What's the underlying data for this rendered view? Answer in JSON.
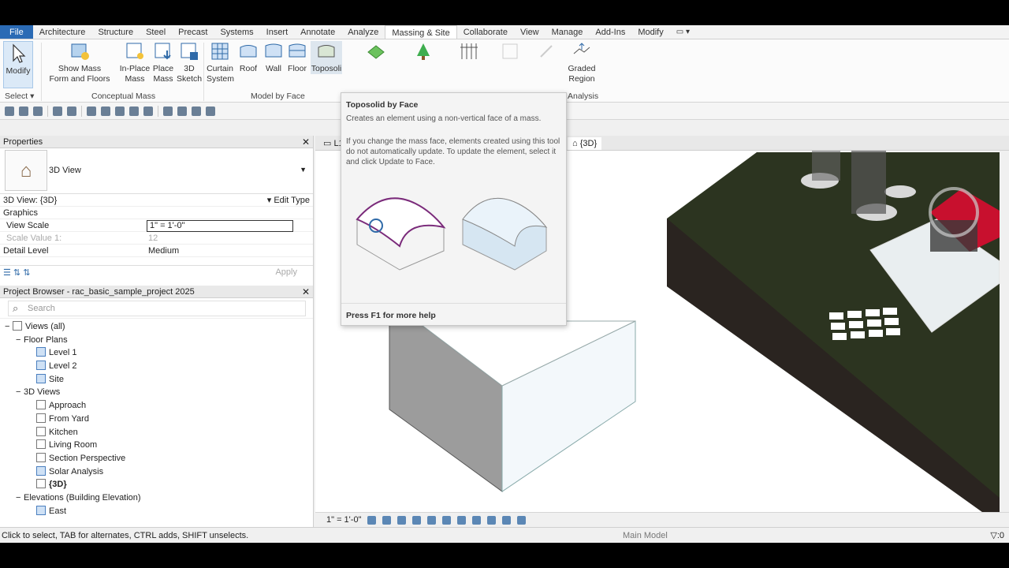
{
  "tabs": [
    "File",
    "Architecture",
    "Structure",
    "Steel",
    "Precast",
    "Systems",
    "Insert",
    "Annotate",
    "Analyze",
    "Massing & Site",
    "Collaborate",
    "View",
    "Manage",
    "Add-Ins",
    "Modify"
  ],
  "active_tab": "Massing & Site",
  "ribbon": {
    "modify": "Modify",
    "select": "Select",
    "show_mass_1": "Show Mass",
    "show_mass_2": "Form and Floors",
    "inplace_1": "In-Place",
    "inplace_2": "Mass",
    "place_1": "Place",
    "place_2": "Mass",
    "sketch_1": "3D",
    "sketch_2": "Sketch",
    "curtain_1": "Curtain",
    "curtain_2": "System",
    "roof": "Roof",
    "wall": "Wall",
    "floor": "Floor",
    "toposolid": "Toposoli",
    "graded_1": "Graded",
    "graded_2": "Region",
    "conceptual_mass": "Conceptual Mass",
    "model_by_face": "Model by Face",
    "analysis": "Analysis"
  },
  "properties": {
    "title": "Properties",
    "type": "3D View",
    "view_label": "3D View: {3D}",
    "edit_type": "Edit Type",
    "graphics": "Graphics",
    "rows": [
      {
        "label": "View Scale",
        "value": "1\" = 1'-0\""
      },
      {
        "label": "Scale Value    1:",
        "value": "12"
      },
      {
        "label": "Detail Level",
        "value": "Medium"
      }
    ],
    "apply": "Apply"
  },
  "browser": {
    "title": "Project Browser - rac_basic_sample_project 2025",
    "search_placeholder": "Search",
    "views_all": "Views (all)",
    "floor_plans": "Floor Plans",
    "floor_items": [
      "Level 1",
      "Level 2",
      "Site"
    ],
    "views_3d": "3D Views",
    "items_3d": [
      "Approach",
      "From Yard",
      "Kitchen",
      "Living Room",
      "Section Perspective",
      "Solar Analysis",
      "{3D}"
    ],
    "elevations": "Elevations (Building Elevation)",
    "elevation_items": [
      "East"
    ]
  },
  "view_tabs": [
    "L1",
    "{3D}"
  ],
  "view_scale": "1\" = 1'-0\"",
  "status": {
    "text": "Click to select, TAB for alternates, CTRL adds, SHIFT unselects.",
    "model": "Main Model",
    "filter": ":0"
  },
  "tooltip": {
    "title": "Toposolid by Face",
    "desc": "Creates an element using a non-vertical face of a mass.",
    "detail": "If you change the mass face, elements created using this tool do not automatically update. To update the element, select it and click Update to Face.",
    "help": "Press F1 for more help"
  }
}
